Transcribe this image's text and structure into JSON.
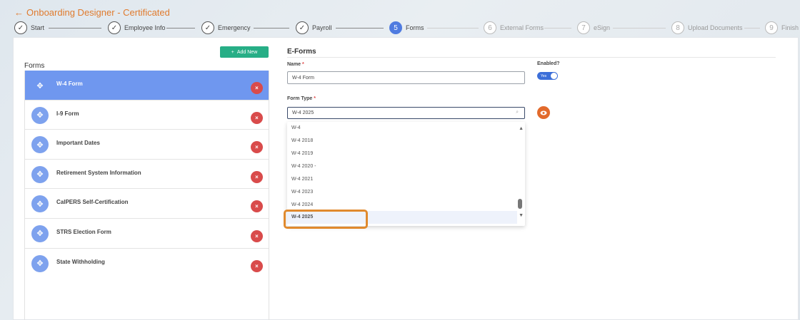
{
  "header": {
    "back_arrow": "←",
    "title": "Onboarding Designer - Certificated"
  },
  "stepper": {
    "steps": [
      {
        "num": "✓",
        "label": "Start",
        "state": "done"
      },
      {
        "num": "✓",
        "label": "Employee Info",
        "state": "done"
      },
      {
        "num": "✓",
        "label": "Emergency",
        "state": "done"
      },
      {
        "num": "✓",
        "label": "Payroll",
        "state": "done"
      },
      {
        "num": "5",
        "label": "Forms",
        "state": "active"
      },
      {
        "num": "6",
        "label": "External Forms",
        "state": "future"
      },
      {
        "num": "7",
        "label": "eSign",
        "state": "future"
      },
      {
        "num": "8",
        "label": "Upload Documents",
        "state": "future"
      },
      {
        "num": "9",
        "label": "Finish",
        "state": "future"
      }
    ]
  },
  "forms_panel": {
    "add_new_label": "Add New",
    "add_new_icon": "+",
    "heading": "Forms",
    "items": [
      {
        "label": "W-4 Form",
        "selected": true
      },
      {
        "label": "I-9 Form",
        "selected": false
      },
      {
        "label": "Important Dates",
        "selected": false
      },
      {
        "label": "Retirement System Information",
        "selected": false
      },
      {
        "label": "CalPERS Self-Certification",
        "selected": false
      },
      {
        "label": "STRS Election Form",
        "selected": false
      },
      {
        "label": "State Withholding",
        "selected": false
      }
    ],
    "drag_icon": "✥",
    "delete_icon": "×"
  },
  "eforms": {
    "title": "E-Forms",
    "name_label": "Name",
    "required_mark": "*",
    "name_value": "W-4 Form",
    "enabled_label": "Enabled?",
    "enabled_toggle_text": "Yes",
    "form_type_label": "Form Type",
    "form_type_value": "W-4 2025",
    "search_icon": "⌕",
    "options": [
      "W-4",
      "W-4 2018",
      "W-4 2019",
      "W-4 2020 -",
      "W-4 2021",
      "W-4 2023",
      "W-4 2024",
      "W-4 2025"
    ],
    "highlighted_option": "W-4 2025",
    "scroll_up": "▲",
    "scroll_down": "▼"
  },
  "colors": {
    "accent_orange": "#e07b2e",
    "active_blue": "#4f7be0",
    "selected_row": "#6f97ef",
    "add_green": "#27ae86",
    "delete_red": "#d94b4b",
    "eye_orange": "#e26a2c",
    "callout": "#e08a2e"
  }
}
